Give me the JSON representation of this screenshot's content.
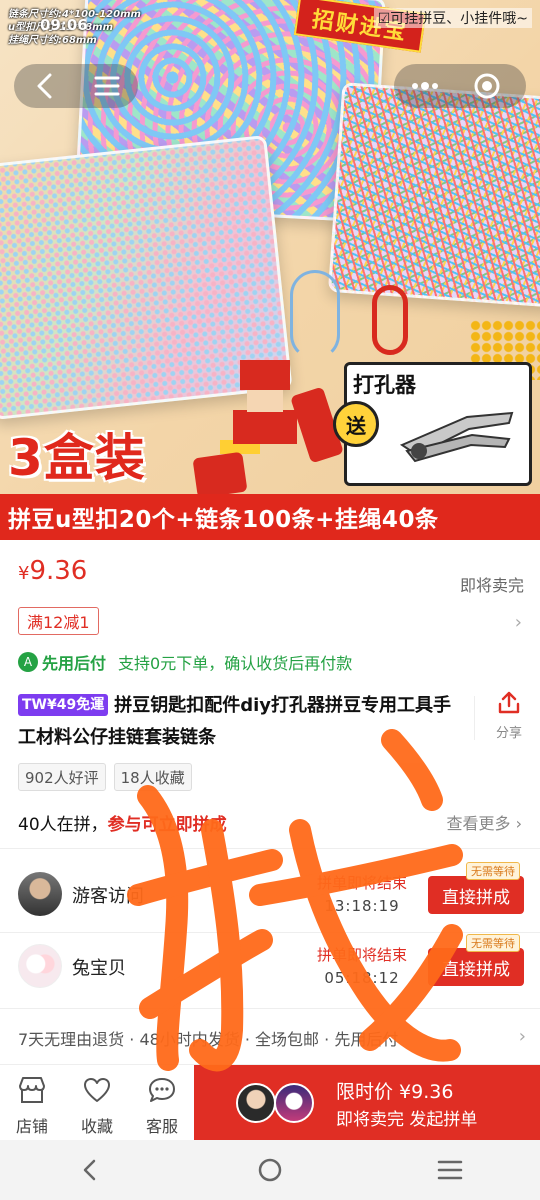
{
  "status_bar": {
    "time": "09:06"
  },
  "hero": {
    "spec_lines": [
      "链条尺寸约:4*100-120mm",
      "u型扣尺寸:13*48mm",
      "挂绳尺寸约:68mm"
    ],
    "sign_text": "招财进宝",
    "tip_text": "☑可挂拼豆、小挂件哦~",
    "gift_title": "打孔器",
    "gift_send": "送",
    "big_text": "3盒装",
    "strip_text": "拼豆u型扣20个+链条100条+挂绳40条"
  },
  "nav": {
    "back_icon": "chevron-left-icon",
    "menu_icon": "hamburger-icon",
    "more_icon": "ellipsis-icon",
    "target_icon": "target-icon"
  },
  "price": {
    "symbol": "¥",
    "value": "9.36",
    "status": "即将卖完",
    "coupon": "满12减1"
  },
  "pay_later": {
    "badge": "A",
    "name": "先用后付",
    "desc": "支持0元下单，确认收货后再付款"
  },
  "product": {
    "tw_badge": "TW¥49免運",
    "title": "拼豆钥匙扣配件diy打孔器拼豆专用工具手工材料公仔挂链套装链条",
    "share_label": "分享"
  },
  "tags": [
    "902人好评",
    "18人收藏"
  ],
  "group": {
    "count_text": "40人在拼，",
    "hint_text": "参与可立即拼成",
    "see_more": "查看更多",
    "items": [
      {
        "name": "游客访问",
        "status": "拼单即将结束",
        "countdown": "13:18:19",
        "button": "直接拼成",
        "no_wait": "无需等待"
      },
      {
        "name": "兔宝贝",
        "status": "拼单即将结束",
        "countdown": "05:18:12",
        "button": "直接拼成",
        "no_wait": "无需等待"
      }
    ]
  },
  "service": {
    "text": "7天无理由退货 · 48小时内发货 · 全场包邮 · 先用后付"
  },
  "bottom_bar": {
    "store": "店铺",
    "favorite": "收藏",
    "service": "客服",
    "buy_line1": "限时价 ¥9.36",
    "buy_line2": "即将卖完 发起拼单"
  },
  "overlay_char": "找",
  "colors": {
    "accent": "#e02e24",
    "green": "#25a244",
    "purple_badge": "#7d3cf0",
    "scribble": "#ff6a1a"
  }
}
